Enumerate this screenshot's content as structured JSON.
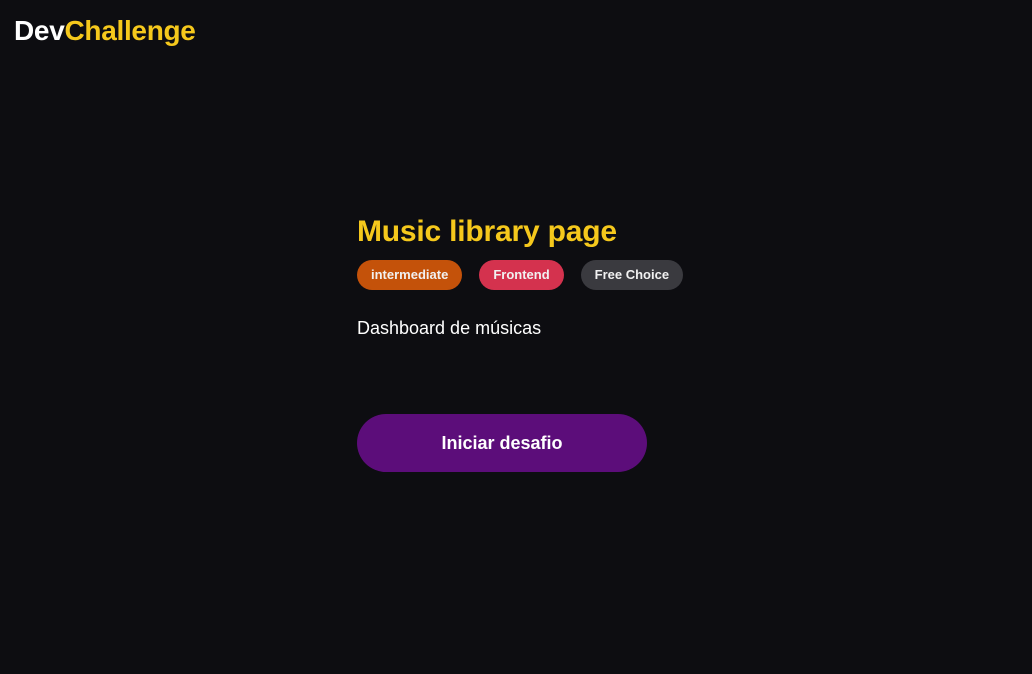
{
  "logo": {
    "part1": "Dev",
    "part2": "Challenge"
  },
  "challenge": {
    "title": "Music library page",
    "tags": [
      {
        "label": "intermediate",
        "color": "#c4520a"
      },
      {
        "label": "Frontend",
        "color": "#d4324e"
      },
      {
        "label": "Free Choice",
        "color": "#3a3a3f"
      }
    ],
    "description": "Dashboard de músicas",
    "cta_label": "Iniciar desafio"
  },
  "colors": {
    "background": "#0d0d11",
    "accent": "#f5c81c",
    "button": "#5c0d7a"
  }
}
